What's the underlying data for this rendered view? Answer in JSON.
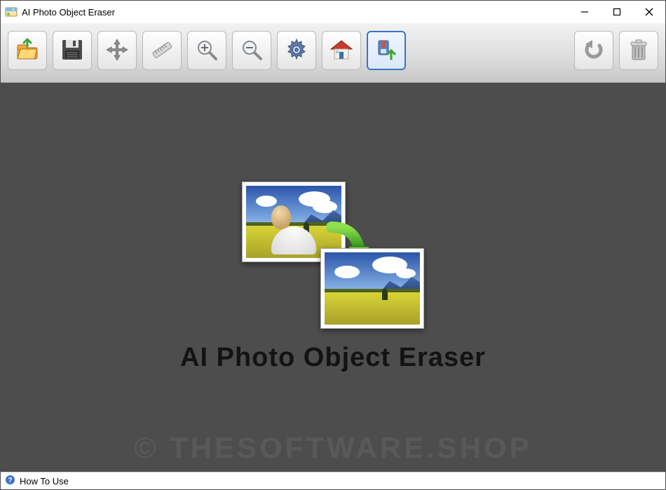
{
  "window": {
    "title": "AI Photo Object Eraser"
  },
  "toolbar": {
    "open_label": "Open",
    "save_label": "Save",
    "move_label": "Move",
    "measure_label": "Measure",
    "zoom_in_label": "Zoom In",
    "zoom_out_label": "Zoom Out",
    "settings_label": "Settings",
    "home_label": "Home",
    "enhance_label": "Enhance",
    "undo_label": "Undo",
    "delete_label": "Delete"
  },
  "main": {
    "headline": "AI Photo Object Eraser",
    "watermark": "© THESOFTWARE.SHOP"
  },
  "statusbar": {
    "how_to_use_label": "How To Use"
  }
}
